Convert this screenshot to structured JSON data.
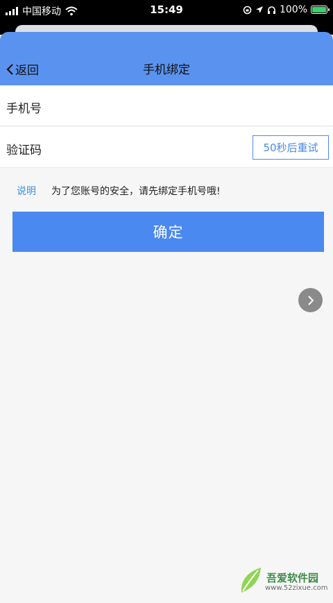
{
  "status_bar": {
    "carrier": "中国移动",
    "time": "15:49",
    "battery": "100%",
    "battery_level": 1.0,
    "icons": [
      "signal-icon",
      "wifi-icon",
      "rotation-lock-icon",
      "location-icon",
      "headphones-icon",
      "battery-icon"
    ]
  },
  "navbar": {
    "back_label": "返回",
    "title": "手机绑定",
    "color": "#5a93ef"
  },
  "form": {
    "phone_label": "手机号",
    "phone_value": "",
    "code_label": "验证码",
    "code_value": "",
    "retry_label": "50秒后重试"
  },
  "note": {
    "key": "说明",
    "text": "为了您账号的安全，请先绑定手机号哦!"
  },
  "confirm_label": "确定",
  "accent": "#4a89ef",
  "watermark": {
    "title": "吾爱软件园",
    "url": "www.52zixue.com"
  }
}
